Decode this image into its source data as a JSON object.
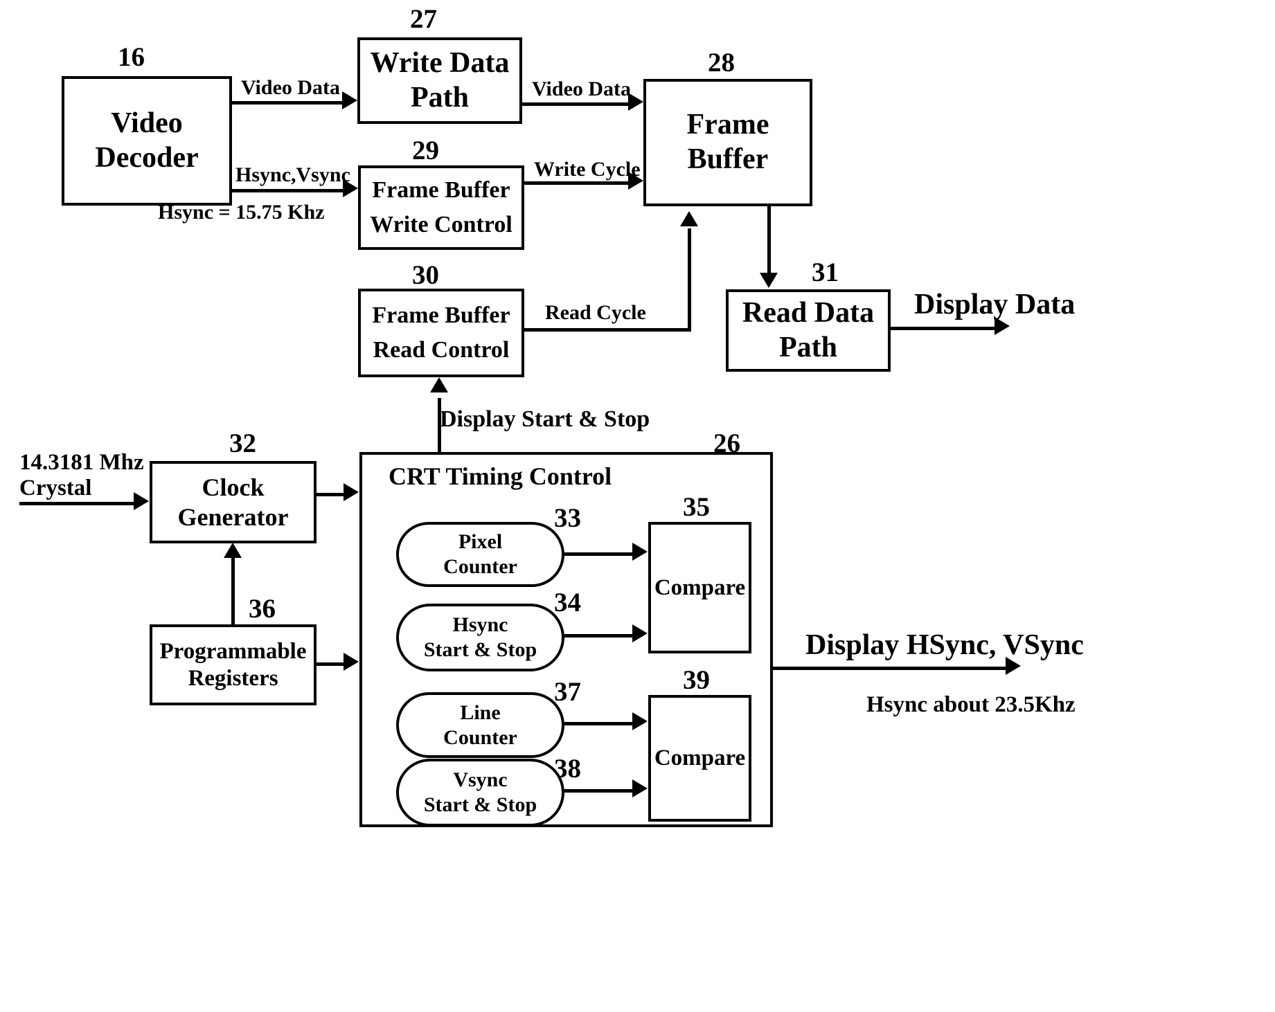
{
  "diagram": {
    "title": "Video frame buffer and CRT timing control block diagram",
    "blocks": {
      "video_decoder": {
        "ref": "16",
        "line1": "Video",
        "line2": "Decoder"
      },
      "write_data_path": {
        "ref": "27",
        "line1": "Write Data",
        "line2": "Path"
      },
      "frame_buffer": {
        "ref": "28",
        "line1": "Frame",
        "line2": "Buffer"
      },
      "fb_write_control": {
        "ref": "29",
        "line1": "Frame  Buffer",
        "line2": "Write  Control"
      },
      "fb_read_control": {
        "ref": "30",
        "line1": "Frame  Buffer",
        "line2": "Read  Control"
      },
      "read_data_path": {
        "ref": "31",
        "line1": "Read Data",
        "line2": "Path"
      },
      "clock_generator": {
        "ref": "32",
        "line1": "Clock",
        "line2": "Generator"
      },
      "programmable_registers": {
        "ref": "36",
        "line1": "Programmable",
        "line2": "Registers"
      },
      "crt_timing_control": {
        "ref": "26",
        "title": "CRT  Timing  Control"
      },
      "pixel_counter": {
        "ref": "33",
        "line1": "Pixel",
        "line2": "Counter"
      },
      "hsync_start_stop": {
        "ref": "34",
        "line1": "Hsync",
        "line2": "Start & Stop"
      },
      "line_counter": {
        "ref": "37",
        "line1": "Line",
        "line2": "Counter"
      },
      "vsync_start_stop": {
        "ref": "38",
        "line1": "Vsync",
        "line2": "Start & Stop"
      },
      "compare_upper": {
        "ref": "35",
        "label": "Compare"
      },
      "compare_lower": {
        "ref": "39",
        "label": "Compare"
      }
    },
    "signal_labels": {
      "video_data_1": "Video Data",
      "video_data_2": "Video Data",
      "hsync_vsync": "Hsync,Vsync",
      "hsync_freq_note": "Hsync = 15.75 Khz",
      "write_cycle": "Write Cycle",
      "read_cycle": "Read Cycle",
      "display_data": "Display Data",
      "display_start_stop": "Display Start & Stop",
      "crystal_input": "14.3181 Mhz",
      "crystal_input_2": "Crystal",
      "display_hsync_vsync": "Display HSync, VSync",
      "hsync_out_note": "Hsync about 23.5Khz"
    }
  }
}
